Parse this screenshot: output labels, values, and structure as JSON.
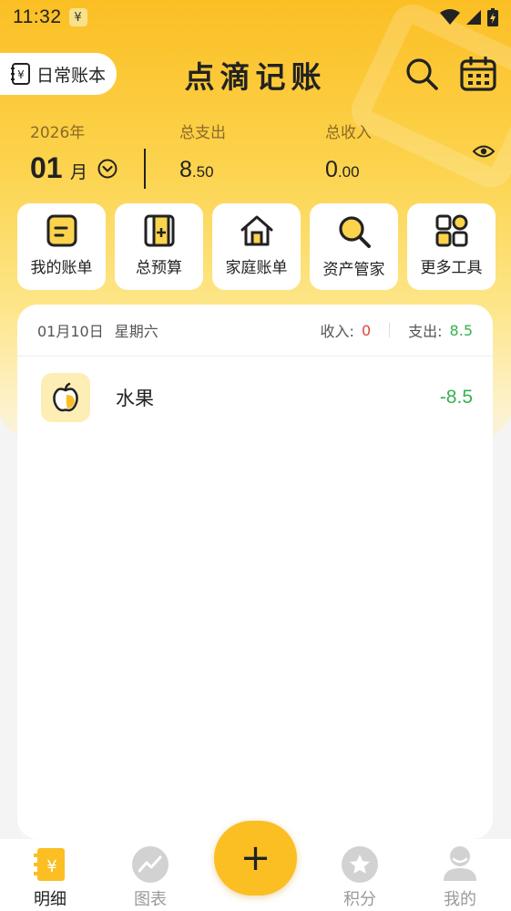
{
  "status_bar": {
    "time": "11:32",
    "notif_icon": "yen-icon"
  },
  "header": {
    "book_label": "日常账本",
    "app_title": "点滴记账"
  },
  "summary": {
    "year": "2026年",
    "month_num": "01",
    "month_unit": "月",
    "expense_label": "总支出",
    "expense_int": "8",
    "expense_dec": ".50",
    "income_label": "总收入",
    "income_int": "0",
    "income_dec": ".00"
  },
  "tools": [
    {
      "label": "我的账单",
      "icon": "bill-icon"
    },
    {
      "label": "总预算",
      "icon": "budget-icon"
    },
    {
      "label": "家庭账单",
      "icon": "home-icon"
    },
    {
      "label": "资产管家",
      "icon": "asset-search-icon"
    },
    {
      "label": "更多工具",
      "icon": "grid-icon"
    }
  ],
  "day": {
    "date": "01月10日",
    "weekday": "星期六",
    "income_label": "收入:",
    "income_value": "0",
    "expense_label": "支出:",
    "expense_value": "8.5"
  },
  "transactions": [
    {
      "name": "水果",
      "amount": "-8.5",
      "icon": "fruit-icon"
    }
  ],
  "tabbar": {
    "tabs": [
      {
        "label": "明细",
        "icon": "ledger-icon",
        "active": true
      },
      {
        "label": "图表",
        "icon": "chart-icon",
        "active": false
      },
      {
        "label": "积分",
        "icon": "star-icon",
        "active": false
      },
      {
        "label": "我的",
        "icon": "user-icon",
        "active": false
      }
    ],
    "add_label": "+"
  },
  "colors": {
    "accent": "#fbbf24",
    "income_red": "#e0453a",
    "expense_green": "#37b24d"
  }
}
